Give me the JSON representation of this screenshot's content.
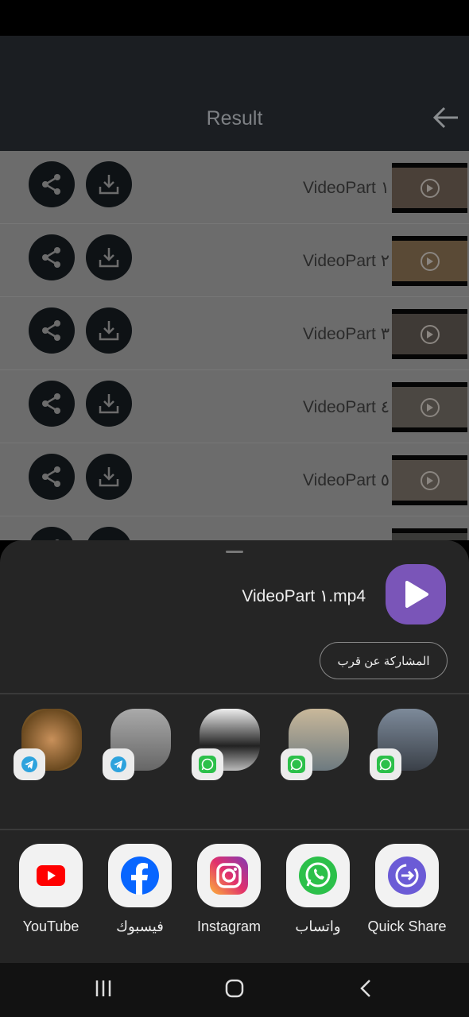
{
  "header": {
    "title": "Result"
  },
  "list": {
    "items": [
      {
        "label": "VideoPart ١"
      },
      {
        "label": "VideoPart ٢"
      },
      {
        "label": "VideoPart ٣"
      },
      {
        "label": "VideoPart ٤"
      },
      {
        "label": "VideoPart ٥"
      },
      {
        "label": ""
      }
    ]
  },
  "share_sheet": {
    "file_name": "VideoPart ١.mp4",
    "nearby_share_label": "المشاركة عن قرب",
    "contacts": [
      {
        "app": "telegram-icon"
      },
      {
        "app": "telegram-icon"
      },
      {
        "app": "whatsapp-icon"
      },
      {
        "app": "whatsapp-icon"
      },
      {
        "app": "whatsapp-icon"
      }
    ],
    "apps": [
      {
        "label": "YouTube"
      },
      {
        "label": "فيسبوك"
      },
      {
        "label": "Instagram"
      },
      {
        "label": "واتساب"
      },
      {
        "label": "Quick Share"
      }
    ]
  },
  "colors": {
    "accent": "#7a55b8",
    "sheet_bg": "#252525"
  }
}
